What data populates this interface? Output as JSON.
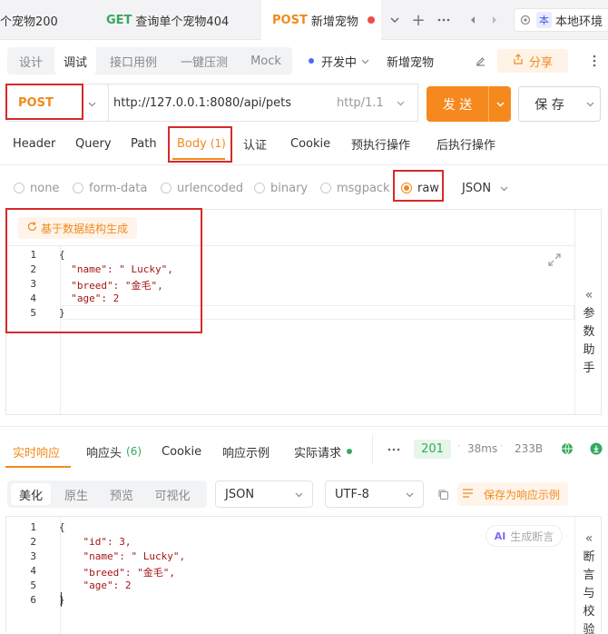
{
  "tabs": [
    {
      "label": "个宠物200"
    },
    {
      "method": "GET",
      "label": "查询单个宠物404"
    },
    {
      "method": "POST",
      "label": "新增宠物"
    }
  ],
  "env": {
    "badge": "本",
    "label": "本地环境"
  },
  "modes": [
    "设计",
    "调试",
    "接口用例",
    "一键压测",
    "Mock"
  ],
  "status": {
    "label": "开发中"
  },
  "api_name": "新增宠物",
  "share_label": "分享",
  "request": {
    "method": "POST",
    "url": "http://127.0.0.1:8080/api/pets",
    "protocol": "http/1.1",
    "send_label": "发 送",
    "save_label": "保 存"
  },
  "param_tabs": [
    "Header",
    "Query",
    "Path",
    "Body",
    "认证",
    "Cookie",
    "预执行操作",
    "后执行操作"
  ],
  "body_count": "(1)",
  "body_types": [
    "none",
    "form-data",
    "urlencoded",
    "binary",
    "msgpack",
    "raw"
  ],
  "raw_format": "JSON",
  "gen_label": "基于数据结构生成",
  "body_lines": [
    "{",
    "  \"name\": \" Lucky\",",
    "  \"breed\": \"金毛\",",
    "  \"age\": 2",
    "}"
  ],
  "param_helper": [
    "参",
    "数",
    "助",
    "手"
  ],
  "resp_tabs": [
    "实时响应",
    "响应头",
    "Cookie",
    "响应示例",
    "实际请求"
  ],
  "resp_header_count": "(6)",
  "resp_meta": {
    "status": "201",
    "time": "38ms",
    "size": "233B"
  },
  "view_modes": [
    "美化",
    "原生",
    "预览",
    "可视化"
  ],
  "resp_format": "JSON",
  "resp_encoding": "UTF-8",
  "save_example_label": "保存为响应示例",
  "ai_label": "生成断言",
  "resp_lines": [
    "{",
    "    \"id\": 3,",
    "    \"name\": \" Lucky\",",
    "    \"breed\": \"金毛\",",
    "    \"age\": 2",
    "}"
  ],
  "assert_helper": [
    "断",
    "言",
    "与",
    "校",
    "验"
  ]
}
